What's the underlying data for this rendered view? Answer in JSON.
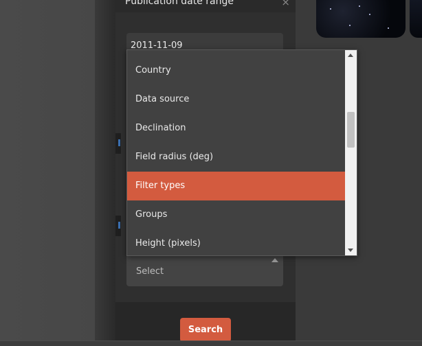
{
  "panel": {
    "title": "Publication date range",
    "close_symbol": "×"
  },
  "date_field": {
    "value": "2011-11-09"
  },
  "dropdown": {
    "items": [
      "Country",
      "Data source",
      "Declination",
      "Field radius (deg)",
      "Filter types",
      "Groups",
      "Height (pixels)"
    ],
    "highlighted": "Filter types",
    "scroll_position": 0.35
  },
  "select_field": {
    "placeholder": "Select"
  },
  "search_button": {
    "label": "Search"
  },
  "icons": {
    "close": "close-icon",
    "caret": "chevron-up-icon",
    "scroll_up": "scroll-up-arrow-icon",
    "scroll_down": "scroll-down-arrow-icon"
  },
  "colors": {
    "accent": "#d35b3f",
    "panel_bg": "#2f2f2f",
    "dropdown_bg": "#414141",
    "text": "#eaeaea"
  }
}
